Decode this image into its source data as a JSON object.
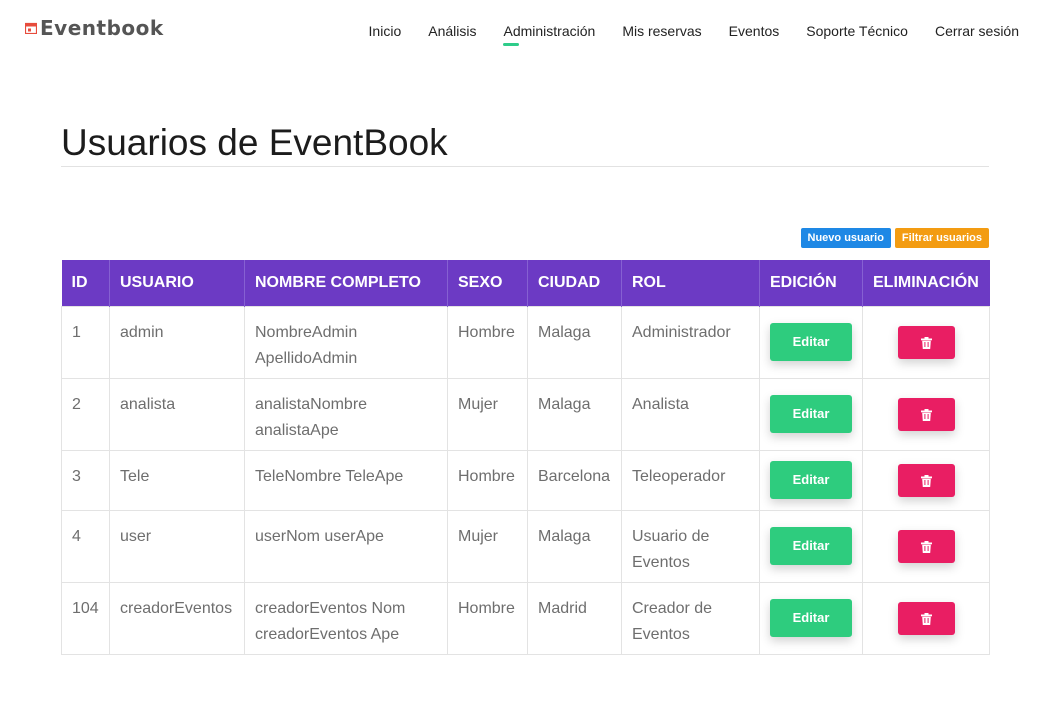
{
  "brand": {
    "name": "Eventbook",
    "icon": "calendar-icon",
    "accent": "#e74c3c"
  },
  "nav": {
    "items": [
      {
        "label": "Inicio"
      },
      {
        "label": "Análisis"
      },
      {
        "label": "Administración",
        "active": true
      },
      {
        "label": "Mis reservas"
      },
      {
        "label": "Eventos"
      },
      {
        "label": "Soporte Técnico"
      },
      {
        "label": "Cerrar sesión"
      }
    ],
    "active_color": "#2ecc8a"
  },
  "page": {
    "title": "Usuarios de EventBook"
  },
  "actions": {
    "new_user": "Nuevo usuario",
    "filter_users": "Filtrar usuarios"
  },
  "table": {
    "header_color": "#6c3ac4",
    "columns": [
      "ID",
      "USUARIO",
      "NOMBRE COMPLETO",
      "SEXO",
      "CIUDAD",
      "ROL",
      "EDICIÓN",
      "ELIMINACIÓN"
    ],
    "edit_label": "Editar",
    "delete_icon": "trash-icon",
    "rows": [
      {
        "id": "1",
        "usuario": "admin",
        "nombre": "NombreAdmin ApellidoAdmin",
        "sexo": "Hombre",
        "ciudad": "Malaga",
        "rol": "Administrador"
      },
      {
        "id": "2",
        "usuario": "analista",
        "nombre": "analistaNombre analistaApe",
        "sexo": "Mujer",
        "ciudad": "Malaga",
        "rol": "Analista"
      },
      {
        "id": "3",
        "usuario": "Tele",
        "nombre": "TeleNombre TeleApe",
        "sexo": "Hombre",
        "ciudad": "Barcelona",
        "rol": "Teleoperador"
      },
      {
        "id": "4",
        "usuario": "user",
        "nombre": "userNom userApe",
        "sexo": "Mujer",
        "ciudad": "Malaga",
        "rol": "Usuario de Eventos"
      },
      {
        "id": "104",
        "usuario": "creadorEventos",
        "nombre": "creadorEventos Nom creadorEventos Ape",
        "sexo": "Hombre",
        "ciudad": "Madrid",
        "rol": "Creador de Eventos"
      }
    ]
  }
}
